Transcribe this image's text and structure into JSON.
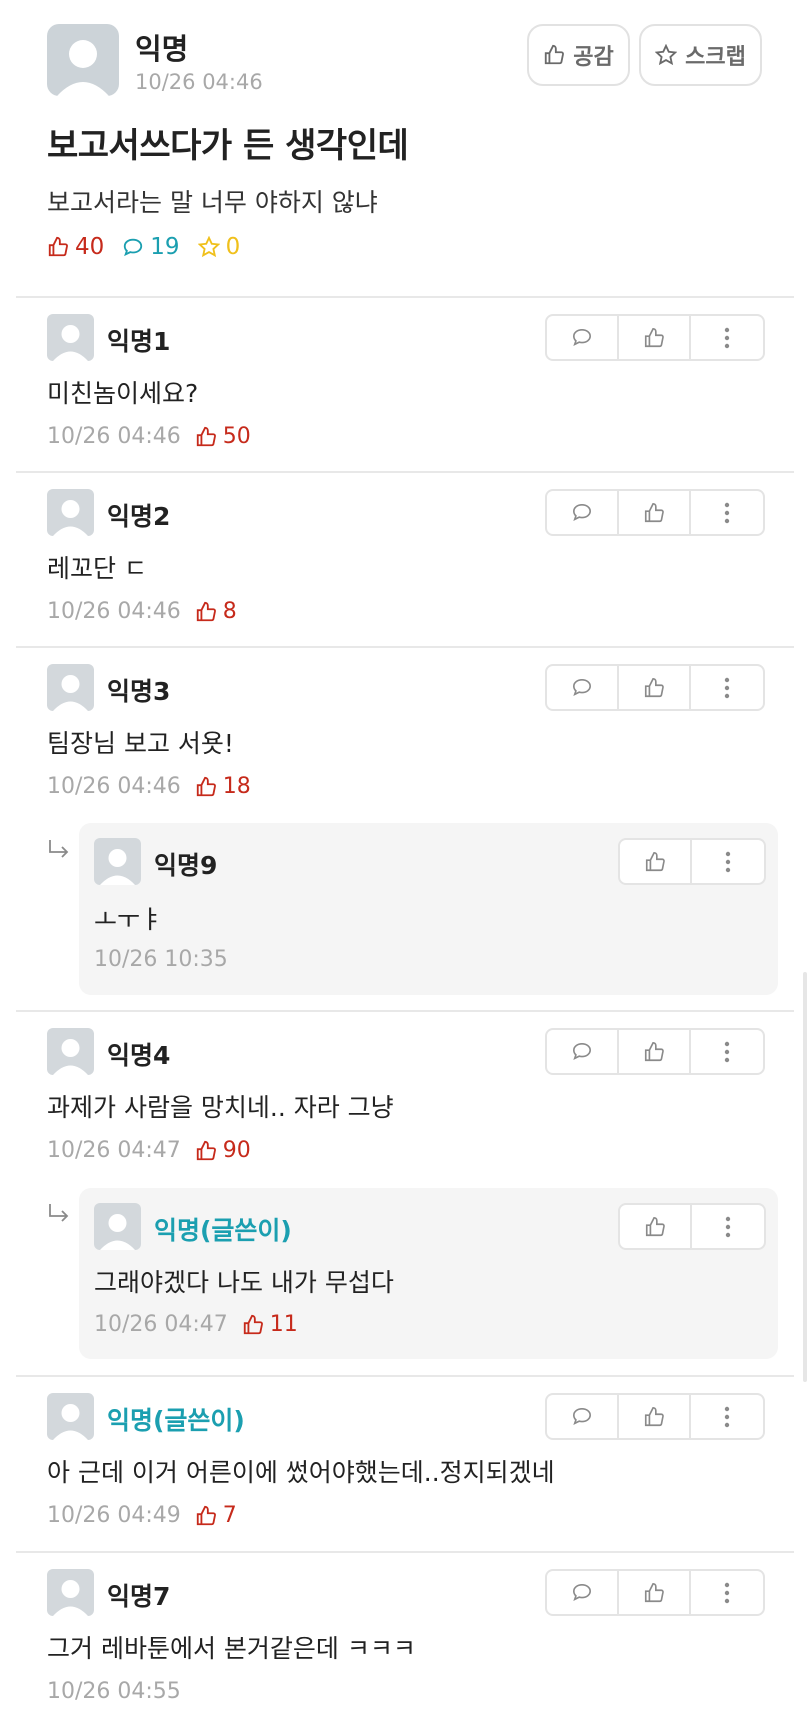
{
  "post": {
    "author": "익명",
    "time": "10/26 04:46",
    "like_label": "공감",
    "scrap_label": "스크랩",
    "title": "보고서쓰다가 든 생각인데",
    "body": "보고서라는 말 너무 야하지 않냐",
    "stats": {
      "likes": "40",
      "comments": "19",
      "scraps": "0"
    }
  },
  "comments": [
    {
      "author": "익명1",
      "text": "미친놈이세요?",
      "time": "10/26 04:46",
      "likes": "50"
    },
    {
      "author": "익명2",
      "text": "레꼬단 ㄷ",
      "time": "10/26 04:46",
      "likes": "8"
    },
    {
      "author": "익명3",
      "text": "팀장님 보고 서욧!",
      "time": "10/26 04:46",
      "likes": "18",
      "reply": {
        "author": "익명9",
        "text": "ㅗㅜㅑ",
        "time": "10/26 10:35"
      }
    },
    {
      "author": "익명4",
      "text": "과제가 사람을 망치네.. 자라 그냥",
      "time": "10/26 04:47",
      "likes": "90",
      "reply": {
        "author": "익명(글쓴이)",
        "text": "그래야겠다 나도 내가 무섭다",
        "time": "10/26 04:47",
        "likes": "11"
      }
    },
    {
      "author": "익명(글쓴이)",
      "text": "아 근데 이거 어른이에 썼어야했는데..정지되겠네",
      "time": "10/26 04:49",
      "likes": "7"
    },
    {
      "author": "익명7",
      "text": "그거 레바툰에서 본거같은데 ㅋㅋㅋ",
      "time": "10/26 04:55"
    }
  ],
  "icons": {
    "thumbs_up": "thumbs-up-icon",
    "comment": "speech-bubble-icon",
    "star": "star-icon",
    "more": "more-vertical-icon",
    "reply_arrow": "reply-arrow-icon"
  },
  "colors": {
    "like_red": "#c62a1b",
    "comment_teal": "#1b9fb0",
    "scrap_yellow": "#f0c01b",
    "op_teal": "#1b9fb0"
  }
}
